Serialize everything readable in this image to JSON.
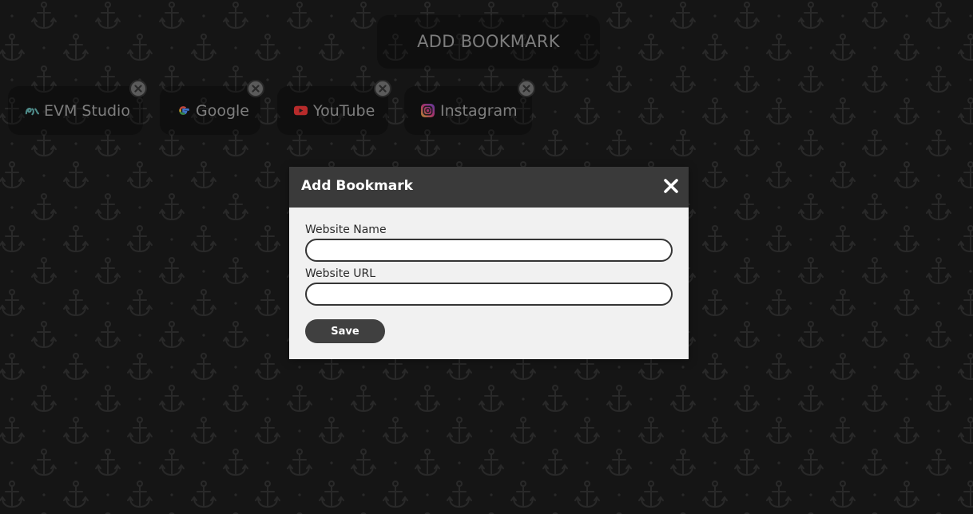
{
  "toolbar": {
    "add_bookmark_label": "ADD BOOKMARK"
  },
  "bookmarks": [
    {
      "label": "EVM Studio",
      "icon": "evm-studio-logo-icon"
    },
    {
      "label": "Google",
      "icon": "google-logo-icon"
    },
    {
      "label": "YouTube",
      "icon": "youtube-logo-icon"
    },
    {
      "label": "Instagram",
      "icon": "instagram-logo-icon"
    }
  ],
  "modal": {
    "title": "Add Bookmark",
    "fields": {
      "name": {
        "label": "Website Name",
        "value": "",
        "placeholder": ""
      },
      "url": {
        "label": "Website URL",
        "value": "",
        "placeholder": ""
      }
    },
    "save_label": "Save"
  },
  "colors": {
    "background": "#1f1f1f",
    "pattern": "#3a3a3a",
    "modal_header": "#3a3a3a",
    "modal_body": "#f1f1f1",
    "button_dark": "#404040"
  }
}
